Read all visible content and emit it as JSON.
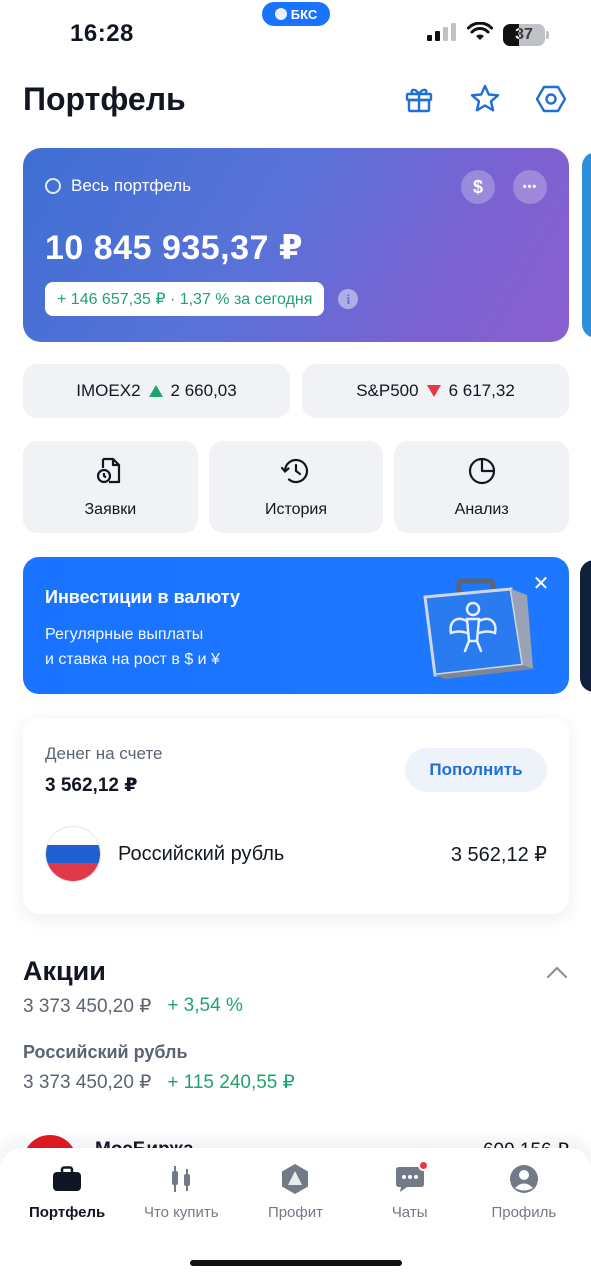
{
  "status_bar": {
    "time": "16:28",
    "pill_label": "БКС",
    "battery": "37",
    "battery_level": 0.37
  },
  "header": {
    "title": "Портфель",
    "icons": [
      "gift-icon",
      "star-icon",
      "settings-hexagon-icon"
    ]
  },
  "portfolio": {
    "label": "Весь портфель",
    "currency_symbol": "$",
    "more_symbol": "•••",
    "value": "10 845 935,37 ₽",
    "change": "+ 146 657,35 ₽ · 1,37 % за сегодня",
    "info_symbol": "i",
    "colors": {
      "gradient_start": "#3f6fd3",
      "gradient_end": "#8c5fcf"
    }
  },
  "tickers": [
    {
      "name": "IMOEX2",
      "direction": "up",
      "value": "2 660,03"
    },
    {
      "name": "S&P500",
      "direction": "down",
      "value": "6 617,32"
    }
  ],
  "quick_actions": [
    {
      "label": "Заявки",
      "icon": "orders-document-clock-icon"
    },
    {
      "label": "История",
      "icon": "history-clock-icon"
    },
    {
      "label": "Анализ",
      "icon": "analysis-pie-icon"
    }
  ],
  "promo": {
    "title": "Инвестиции в валюту",
    "subtitle_line1": "Регулярные выплаты",
    "subtitle_line2": "и ставка на рост в $ и ¥",
    "close_symbol": "✕"
  },
  "money": {
    "label": "Денег на счете",
    "value": "3 562,12 ₽",
    "topup_label": "Пополнить",
    "currency_name": "Российский рубль",
    "currency_value": "3 562,12 ₽"
  },
  "shares": {
    "title": "Акции",
    "total": "3 373 450,20 ₽",
    "total_change": "+ 3,54 %",
    "group_title": "Российский рубль",
    "group_total": "3 373 450,20 ₽",
    "group_change": "+ 115 240,55 ₽",
    "partial_name": "МосБиржа",
    "partial_value": "609 156 ₽"
  },
  "nav": [
    {
      "label": "Портфель",
      "icon": "briefcase-icon",
      "active": true
    },
    {
      "label": "Что купить",
      "icon": "candles-icon",
      "active": false
    },
    {
      "label": "Профит",
      "icon": "profit-hexagon-icon",
      "active": false
    },
    {
      "label": "Чаты",
      "icon": "chat-icon",
      "active": false,
      "badge": true
    },
    {
      "label": "Профиль",
      "icon": "profile-icon",
      "active": false
    }
  ]
}
